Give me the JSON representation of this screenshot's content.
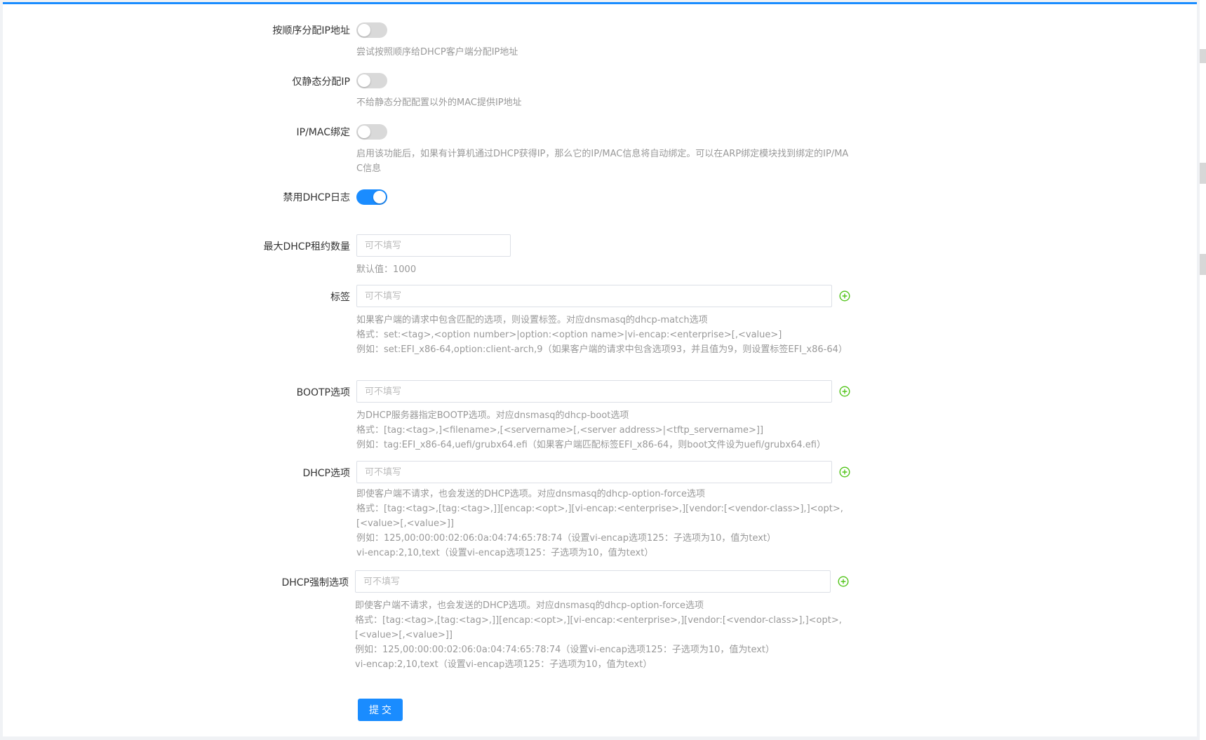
{
  "form": {
    "seq_ip": {
      "label": "按顺序分配IP地址",
      "enabled": false,
      "help": [
        "尝试按照顺序给DHCP客户端分配IP地址"
      ]
    },
    "static_only": {
      "label": "仅静态分配IP",
      "enabled": false,
      "help": [
        "不给静态分配配置以外的MAC提供IP地址"
      ]
    },
    "ipmac_bind": {
      "label": "IP/MAC绑定",
      "enabled": false,
      "help": [
        "启用该功能后，如果有计算机通过DHCP获得IP，那么它的IP/MAC信息将自动绑定。可以在ARP绑定模块找到绑定的IP/MAC信息"
      ]
    },
    "disable_log": {
      "label": "禁用DHCP日志",
      "enabled": true
    },
    "max_lease": {
      "label": "最大DHCP租约数量",
      "placeholder": "可不填写",
      "value": "",
      "help": [
        "默认值：1000"
      ]
    },
    "tag": {
      "label": "标签",
      "placeholder": "可不填写",
      "value": "",
      "help": [
        "如果客户端的请求中包含匹配的选项，则设置标签。对应dnsmasq的dhcp-match选项",
        "格式：set:<tag>,<option number>|option:<option name>|vi-encap:<enterprise>[,<value>]",
        "例如：set:EFI_x86-64,option:client-arch,9（如果客户端的请求中包含选项93，并且值为9，则设置标签EFI_x86-64）"
      ]
    },
    "bootp": {
      "label": "BOOTP选项",
      "placeholder": "可不填写",
      "value": "",
      "help": [
        "为DHCP服务器指定BOOTP选项。对应dnsmasq的dhcp-boot选项",
        "格式：[tag:<tag>,]<filename>,[<servername>[,<server address>|<tftp_servername>]]",
        "例如：tag:EFI_x86-64,uefi/grubx64.efi（如果客户端匹配标签EFI_x86-64，则boot文件设为uefi/grubx64.efi）"
      ]
    },
    "dhcp_option": {
      "label": "DHCP选项",
      "placeholder": "可不填写",
      "value": "",
      "help": [
        "即使客户端不请求，也会发送的DHCP选项。对应dnsmasq的dhcp-option-force选项",
        "格式：[tag:<tag>,[tag:<tag>,]][encap:<opt>,][vi-encap:<enterprise>,][vendor:[<vendor-class>],]<opt>,[<value>[,<value>]]",
        "例如：125,00:00:00:02:06:0a:04:74:65:78:74（设置vi-encap选项125：子选项为10，值为text）",
        "vi-encap:2,10,text（设置vi-encap选项125：子选项为10，值为text）"
      ]
    },
    "dhcp_force": {
      "label": "DHCP强制选项",
      "placeholder": "可不填写",
      "value": "",
      "help": [
        "即使客户端不请求，也会发送的DHCP选项。对应dnsmasq的dhcp-option-force选项",
        "格式：[tag:<tag>,[tag:<tag>,]][encap:<opt>,][vi-encap:<enterprise>,][vendor:[<vendor-class>],]<opt>,[<value>[,<value>]]",
        "例如：125,00:00:00:02:06:0a:04:74:65:78:74（设置vi-encap选项125：子选项为10，值为text）",
        "vi-encap:2,10,text（设置vi-encap选项125：子选项为10，值为text）"
      ]
    },
    "submit_label": "提交"
  },
  "icons": {
    "add": "plus-circle-icon"
  },
  "colors": {
    "accent": "#1a8cff",
    "add_icon": "#52c41a",
    "toggle_off": "#d9d9d9",
    "help_text": "#999999"
  }
}
